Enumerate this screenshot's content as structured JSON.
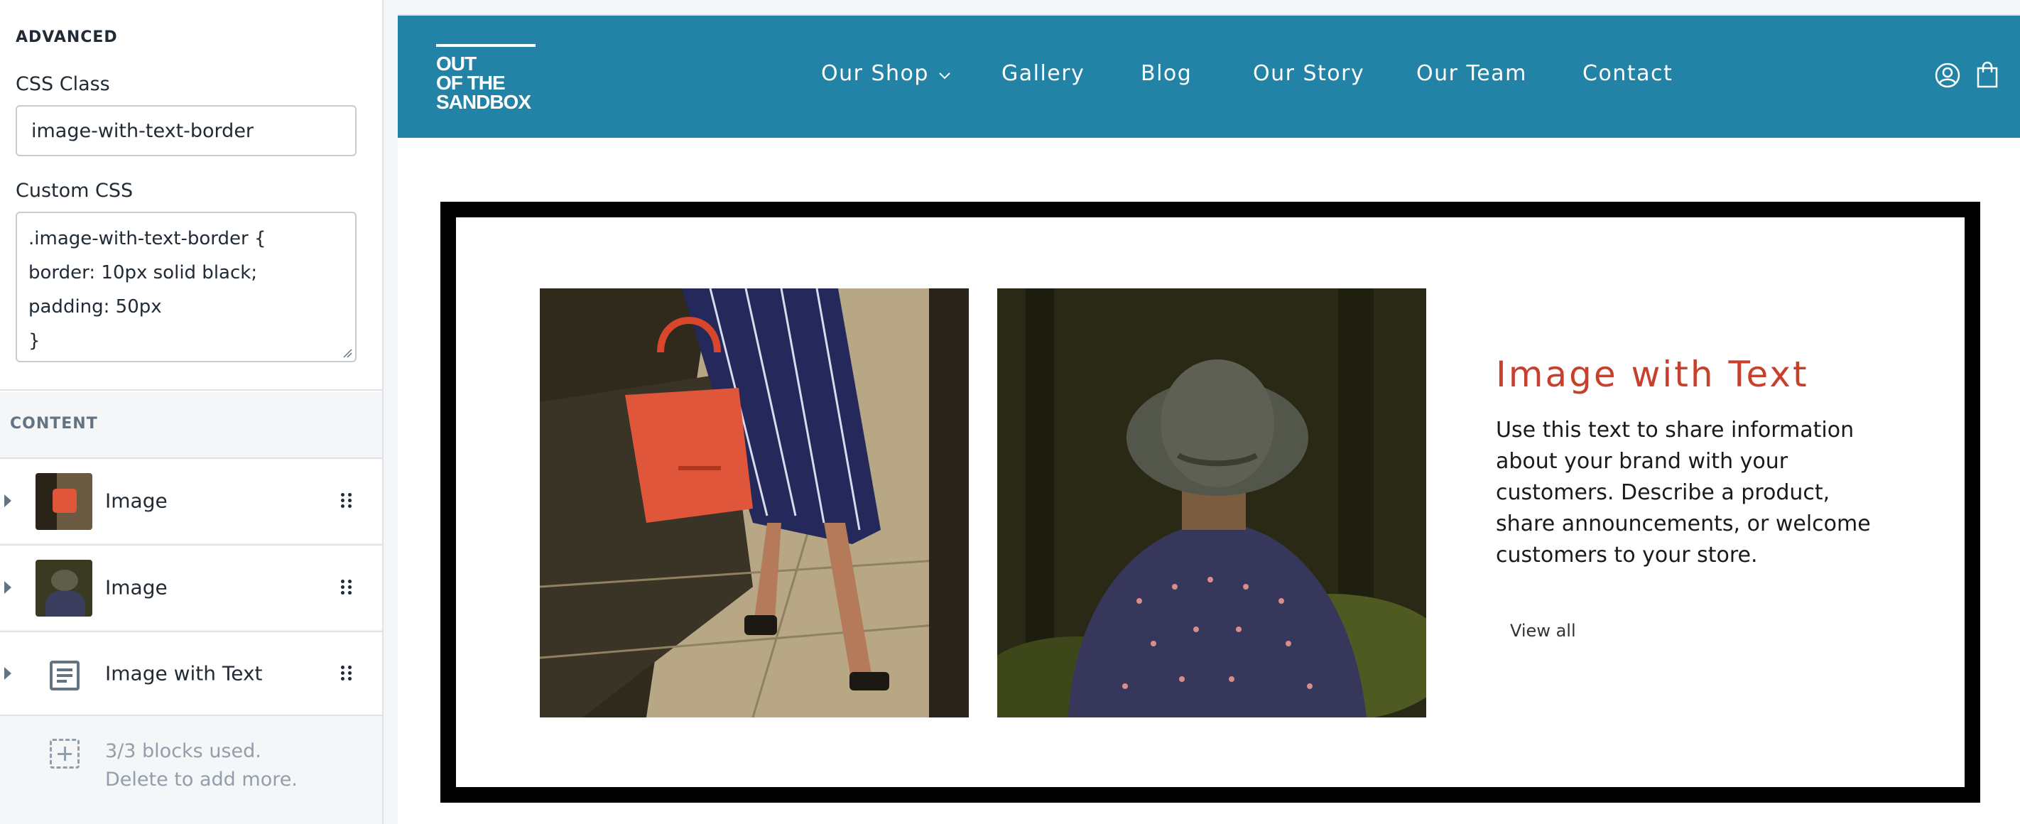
{
  "advanced": {
    "heading": "ADVANCED",
    "css_class_label": "CSS Class",
    "css_class_value": "image-with-text-border",
    "custom_css_label": "Custom CSS",
    "custom_css_lines": [
      ".image-with-text-border {",
      "border: 10px solid black;",
      "padding: 50px",
      "}"
    ]
  },
  "content": {
    "heading": "CONTENT",
    "blocks": [
      {
        "label": "Image",
        "icon": "image-thumbnail-bag"
      },
      {
        "label": "Image",
        "icon": "image-thumbnail-hat"
      },
      {
        "label": "Image with Text",
        "icon": "text-block-icon"
      }
    ],
    "limit_line_1": "3/3 blocks used.",
    "limit_line_2": "Delete to add more."
  },
  "store": {
    "logo_lines": [
      "OUT",
      "OF THE",
      "SANDBOX"
    ],
    "nav": [
      "Our Shop",
      "Gallery",
      "Blog",
      "Our Story",
      "Our Team",
      "Contact"
    ],
    "header_color": "#2383a6"
  },
  "section": {
    "heading": "Image with Text",
    "body": "Use this text to share information about your brand with your customers. Describe a product, share announcements, or welcome customers to your store.",
    "link_label": "View all",
    "heading_color": "#c7402d",
    "border_color": "#000000"
  }
}
